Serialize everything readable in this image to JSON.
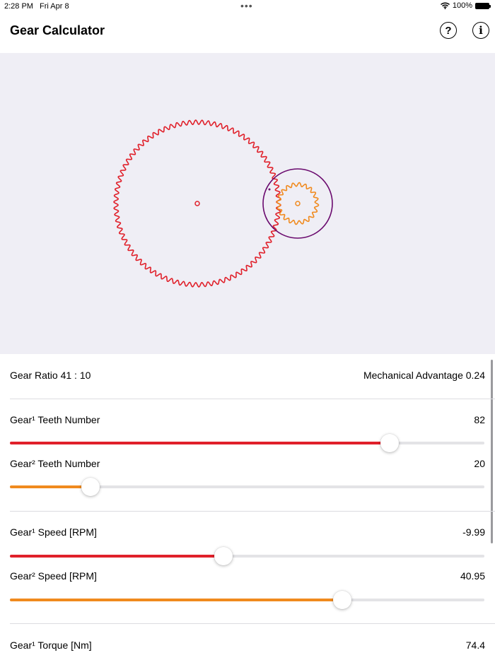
{
  "status": {
    "time": "2:28 PM",
    "date": "Fri Apr 8",
    "battery": "100%"
  },
  "nav": {
    "title": "Gear Calculator",
    "help_icon": "question-circle-icon",
    "info_icon": "info-circle-icon"
  },
  "colors": {
    "gear1": "#e0202a",
    "gear2": "#f08a1e",
    "gear2_outline": "#6a0a6e",
    "track": "#e3e3e6",
    "canvas_bg": "#efeef5"
  },
  "summary": {
    "ratio": "Gear Ratio 41 : 10",
    "advantage": "Mechanical Advantage 0.24"
  },
  "controls": {
    "gear1_teeth": {
      "label": "Gear¹ Teeth Number",
      "value": "82",
      "fraction": 0.8
    },
    "gear2_teeth": {
      "label": "Gear² Teeth Number",
      "value": "20",
      "fraction": 0.17
    },
    "gear1_speed": {
      "label": "Gear¹ Speed [RPM]",
      "value": "-9.99",
      "fraction": 0.45
    },
    "gear2_speed": {
      "label": "Gear² Speed [RPM]",
      "value": "40.95",
      "fraction": 0.7
    },
    "gear1_torque": {
      "label": "Gear¹ Torque [Nm]",
      "value": "74.4"
    }
  },
  "gears": {
    "gear1_teeth": 82,
    "gear2_teeth": 20
  }
}
